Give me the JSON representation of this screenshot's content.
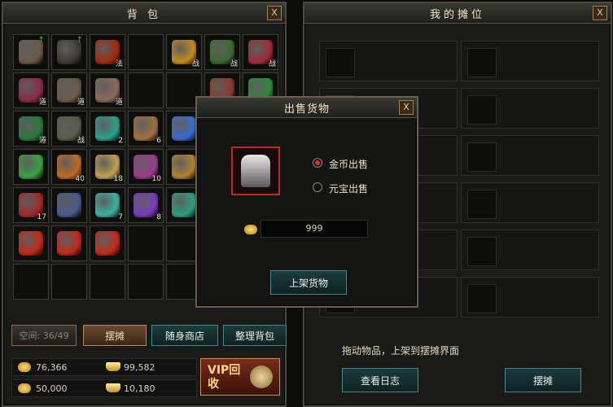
{
  "bag": {
    "title": "背 包",
    "close": "X",
    "slots": [
      {
        "color": "#6a5a4a",
        "tag": "",
        "up": "↑"
      },
      {
        "color": "#3e3a36",
        "tag": "",
        "up": "↑"
      },
      {
        "color": "#a02a10",
        "tag": "法",
        "up": ""
      },
      {
        "color": "",
        "tag": "",
        "up": ""
      },
      {
        "color": "#c08a20",
        "tag": "战",
        "up": ""
      },
      {
        "color": "#3a6a30",
        "tag": "战",
        "up": ""
      },
      {
        "color": "#a02a3a",
        "tag": "战",
        "up": ""
      },
      {
        "color": "#8a2a4a",
        "tag": "道",
        "up": ""
      },
      {
        "color": "#6a5a4a",
        "tag": "道",
        "up": ""
      },
      {
        "color": "#8a6a5a",
        "tag": "道",
        "up": ""
      },
      {
        "color": "",
        "tag": "",
        "up": ""
      },
      {
        "color": "",
        "tag": "",
        "up": ""
      },
      {
        "color": "#8a3a2a",
        "tag": "",
        "up": ""
      },
      {
        "color": "#2a8a3a",
        "tag": "",
        "up": ""
      },
      {
        "color": "#2a7a3a",
        "tag": "道",
        "up": ""
      },
      {
        "color": "#5a5a4a",
        "tag": "战",
        "up": ""
      },
      {
        "color": "#2aa08a",
        "tag": "2",
        "up": ""
      },
      {
        "color": "#a07040",
        "tag": "6",
        "up": ""
      },
      {
        "color": "#3a6ad0",
        "tag": "",
        "up": ""
      },
      {
        "color": "",
        "tag": "",
        "up": ""
      },
      {
        "color": "",
        "tag": "",
        "up": ""
      },
      {
        "color": "#3aa040",
        "tag": "",
        "up": ""
      },
      {
        "color": "#c06a20",
        "tag": "40",
        "up": ""
      },
      {
        "color": "#c0a050",
        "tag": "18",
        "up": ""
      },
      {
        "color": "#9a3a8a",
        "tag": "10",
        "up": ""
      },
      {
        "color": "#b08030",
        "tag": "",
        "up": ""
      },
      {
        "color": "",
        "tag": "",
        "up": ""
      },
      {
        "color": "",
        "tag": "",
        "up": ""
      },
      {
        "color": "#a02a2a",
        "tag": "17",
        "up": ""
      },
      {
        "color": "#4a5a8a",
        "tag": "",
        "up": ""
      },
      {
        "color": "#3ab0a0",
        "tag": "7",
        "up": ""
      },
      {
        "color": "#7a3ac0",
        "tag": "8",
        "up": ""
      },
      {
        "color": "#2aa080",
        "tag": "",
        "up": ""
      },
      {
        "color": "",
        "tag": "",
        "up": ""
      },
      {
        "color": "",
        "tag": "",
        "up": ""
      },
      {
        "color": "#c02a1a",
        "tag": "",
        "up": ""
      },
      {
        "color": "#c02a1a",
        "tag": "",
        "up": ""
      },
      {
        "color": "#c02a1a",
        "tag": "",
        "up": ""
      },
      {
        "color": "",
        "tag": "",
        "up": ""
      },
      {
        "color": "",
        "tag": "",
        "up": ""
      },
      {
        "color": "",
        "tag": "",
        "up": ""
      },
      {
        "color": "",
        "tag": "",
        "up": ""
      },
      {
        "color": "",
        "tag": "",
        "up": ""
      },
      {
        "color": "",
        "tag": "",
        "up": ""
      },
      {
        "color": "",
        "tag": "",
        "up": ""
      },
      {
        "color": "",
        "tag": "",
        "up": ""
      },
      {
        "color": "",
        "tag": "",
        "up": ""
      },
      {
        "color": "",
        "tag": "",
        "up": ""
      },
      {
        "color": "",
        "tag": "",
        "up": ""
      }
    ],
    "capacity": "空间: 36/49",
    "stall_btn": "摆摊",
    "shop_btn": "随身商店",
    "sort_btn": "整理背包",
    "gold": "76,366",
    "ingot": "99,582",
    "bound_gold": "50,000",
    "bound_ingot": "10,180",
    "vip_label": "VIP回收"
  },
  "stall": {
    "title": "我的摊位",
    "close": "X",
    "hint": "拖动物品，上架到摆摊界面",
    "view_log_btn": "查看日志",
    "stall_btn": "摆摊"
  },
  "sell": {
    "title": "出售货物",
    "close": "X",
    "option_gold": "金币出售",
    "option_yuanbao": "元宝出售",
    "price": "999",
    "list_btn": "上架货物"
  },
  "colors": {
    "gold_text": "#f0e6c8",
    "accent_red": "#e03a1a",
    "teal": "#3e8a8a"
  }
}
